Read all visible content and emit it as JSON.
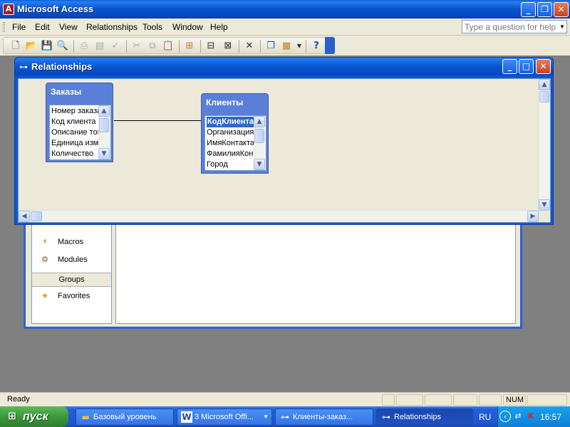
{
  "app": {
    "title": "Microsoft Access",
    "icon": "access-key-icon",
    "controls": {
      "minimize": "_",
      "restore": "❐",
      "close": "✕"
    }
  },
  "menubar": {
    "items": [
      {
        "label": "File"
      },
      {
        "label": "Edit"
      },
      {
        "label": "View"
      },
      {
        "label": "Relationships"
      },
      {
        "label": "Tools"
      },
      {
        "label": "Window"
      },
      {
        "label": "Help"
      }
    ],
    "ask_placeholder": "Type a question for help"
  },
  "relationships_window": {
    "title": "Relationships",
    "tables": [
      {
        "name": "Заказы",
        "fields": [
          "Номер заказа",
          "Код клиента",
          "Описание товара",
          "Единица измерения",
          "Количество"
        ]
      },
      {
        "name": "Клиенты",
        "fields": [
          "КодКлиента",
          "Организация",
          "ИмяКонтакта",
          "ФамилияКонтакта",
          "Город"
        ],
        "selected_field": "КодКлиента"
      }
    ]
  },
  "database_window": {
    "objects": [
      {
        "label": "Macros",
        "icon": "macro-icon"
      },
      {
        "label": "Modules",
        "icon": "module-icon"
      }
    ],
    "groups_label": "Groups",
    "groups": [
      {
        "label": "Favorites",
        "icon": "favorites-folder-icon"
      }
    ]
  },
  "statusbar": {
    "status": "Ready",
    "num_indicator": "NUM"
  },
  "taskbar": {
    "start_label": "пуск",
    "tasks": [
      {
        "label": "Базовый уровень",
        "icon": "folder-icon"
      },
      {
        "label": "3 Microsoft Offi...",
        "icon": "word-icon"
      },
      {
        "label": "Клиенты-заказ...",
        "icon": "access-icon"
      },
      {
        "label": "Relationships",
        "icon": "relationships-icon",
        "active": true
      }
    ],
    "language": "RU",
    "clock": "16:57"
  },
  "colors": {
    "xp_blue": "#0854d0",
    "table_header": "#5a7fd8",
    "selection": "#316ac5",
    "start_green": "#3a9a3a"
  }
}
